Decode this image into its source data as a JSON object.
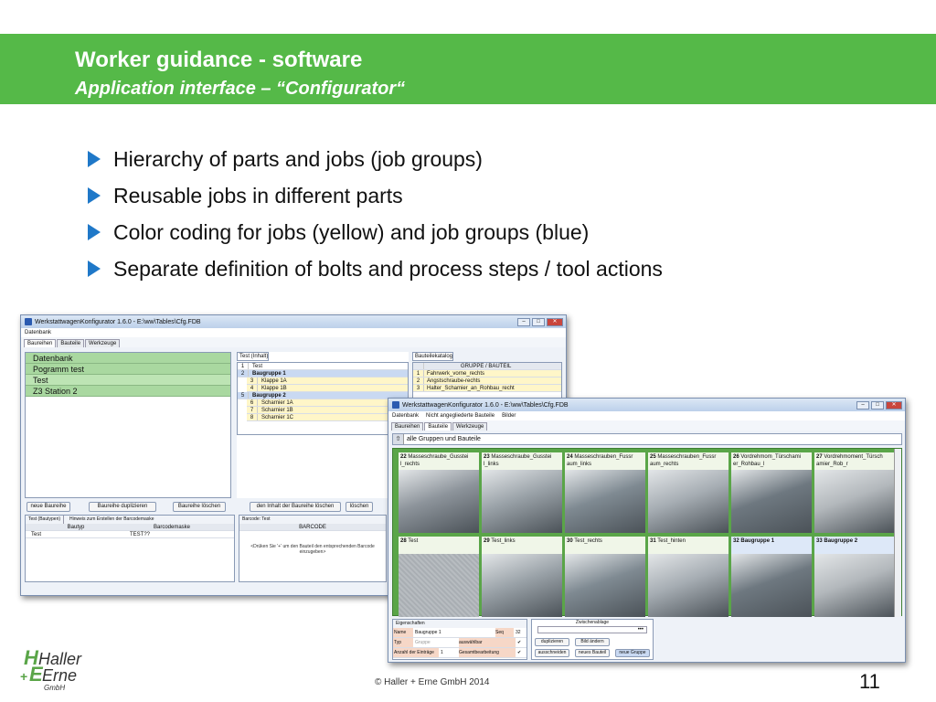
{
  "banner": {
    "title": "Worker guidance - software",
    "subtitle": "Application interface – “Configurator“"
  },
  "bullets": [
    "Hierarchy of parts and jobs (job groups)",
    "Reusable jobs in different parts",
    "Color coding for jobs (yellow) and job groups (blue)",
    "Separate definition of bolts and process steps / tool actions"
  ],
  "win1": {
    "title": "WerkstattwagenKonfigurator 1.6.0 - E:\\ww\\Tables\\Cfg.FDB",
    "menu": [
      "Datenbank"
    ],
    "tabs": [
      "Baureihen",
      "Bauteile",
      "Werkzeuge"
    ],
    "list": [
      "Datenbank",
      "Pogramm test",
      "Test",
      "Z3 Station 2"
    ],
    "mid_header": "Test (Inhalt)",
    "mid_rows": [
      {
        "n": "1",
        "t": "Test"
      },
      {
        "n": "2",
        "t": "Baugruppe 1"
      },
      {
        "n": "3",
        "t": "Klappe 1A"
      },
      {
        "n": "4",
        "t": "Klappe 1B"
      },
      {
        "n": "5",
        "t": "Baugruppe 2"
      },
      {
        "n": "6",
        "t": "Scharnier 1A"
      },
      {
        "n": "7",
        "t": "Scharnier 1B"
      },
      {
        "n": "8",
        "t": "Scharnier 1C"
      }
    ],
    "cat_header": "Bauteilekatalog",
    "cat_col": "GRUPPE / BAUTEIL",
    "cat_rows": [
      {
        "n": "1",
        "t": "Fahrwerk_vorne_rechts"
      },
      {
        "n": "2",
        "t": "Angstschraube-rechts"
      },
      {
        "n": "3",
        "t": "Halter_Schamier_an_Rohbau_recht"
      }
    ],
    "buttons": [
      "neue Baureihe",
      "Baureihe duplizieren",
      "Baureihe löschen",
      "den Inhalt der Baureihe löschen",
      "löschen"
    ],
    "bottom_left_tab": "Test (Bautypen)",
    "bottom_left_hint": "Hinweis zum Erstellen der Barcodemaske",
    "bottom_left_cols": [
      "Bautyp",
      "Barcodemaske"
    ],
    "bottom_left_row": [
      "Test",
      "TEST??"
    ],
    "bottom_mid_tab": "Barcode: Test",
    "bottom_mid_col": "BARCODE",
    "bottom_mid_text": "<Drüken Sie '+' um den Bauteil den entsprechenden Barcode einzugeben>"
  },
  "win2": {
    "title": "WerkstattwagenKonfigurator 1.6.0 - E:\\ww\\Tables\\Cfg.FDB",
    "menu": [
      "Datenbank",
      "Nicht angegliederte Bauteile",
      "Bilder"
    ],
    "tabs": [
      "Baureihen",
      "Bauteile",
      "Werkzeuge"
    ],
    "filter": "alle Gruppen und Bauteile",
    "cells": [
      {
        "n": "22",
        "t": "Masseschraube_Gusstei l_rechts",
        "blue": false
      },
      {
        "n": "23",
        "t": "Masseschraube_Gusstei l_links",
        "blue": false
      },
      {
        "n": "24",
        "t": "Masseschrauben_Fussr aum_links",
        "blue": false
      },
      {
        "n": "25",
        "t": "Masseschrauben_Fussr aum_rechts",
        "blue": false
      },
      {
        "n": "26",
        "t": "Vordrehmom_Türschami er_Rohbau_l",
        "blue": false
      },
      {
        "n": "27",
        "t": "Vordrehmoment_Türsch amier_Rob_r",
        "blue": false
      },
      {
        "n": "28",
        "t": "Test",
        "blue": false
      },
      {
        "n": "29",
        "t": "Test_links",
        "blue": false
      },
      {
        "n": "30",
        "t": "Test_rechts",
        "blue": false
      },
      {
        "n": "31",
        "t": "Test_hinten",
        "blue": false
      },
      {
        "n": "32",
        "t": "Baugruppe 1",
        "blue": true
      },
      {
        "n": "33",
        "t": "Baugruppe 2",
        "blue": true
      }
    ],
    "props_tab": "Eigenschaften",
    "props": [
      {
        "k": "Name",
        "v": "Baugruppe 1",
        "k2": "Seq",
        "v2": "32"
      },
      {
        "k": "Typ",
        "v": "Gruppe",
        "k2": "auswählbar",
        "v2": "✔"
      },
      {
        "k": "Anzahl der Einträge",
        "v": "1",
        "k2": "Gesamtbearbeitung",
        "v2": "✔"
      }
    ],
    "clip_label": "Zwischenablage",
    "clip_buttons": [
      "duplizieren",
      "Bild ändern",
      "ausschneiden",
      "neues Bauteil",
      "neue Gruppe"
    ]
  },
  "logo": {
    "line1": "Haller",
    "line2": "Erne",
    "line3": "GmbH"
  },
  "footer": "© Haller + Erne GmbH 2014",
  "page_number": "11"
}
